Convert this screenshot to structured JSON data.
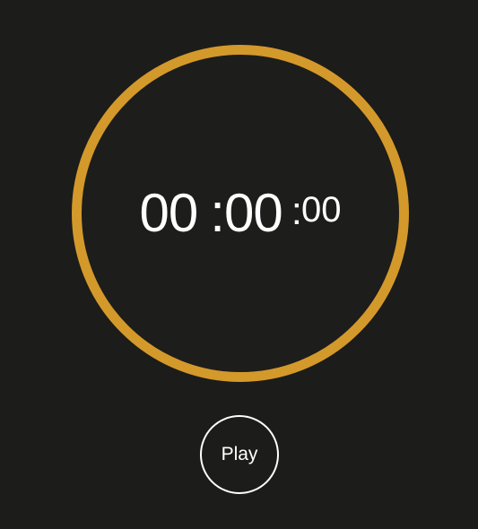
{
  "timer": {
    "hours": "00",
    "minutes": ":00",
    "seconds": ":00",
    "small_seconds": "00"
  },
  "controls": {
    "play_label": "Play"
  },
  "colors": {
    "background": "#1c1c1a",
    "ring": "#d4992b",
    "text": "#ffffff"
  }
}
